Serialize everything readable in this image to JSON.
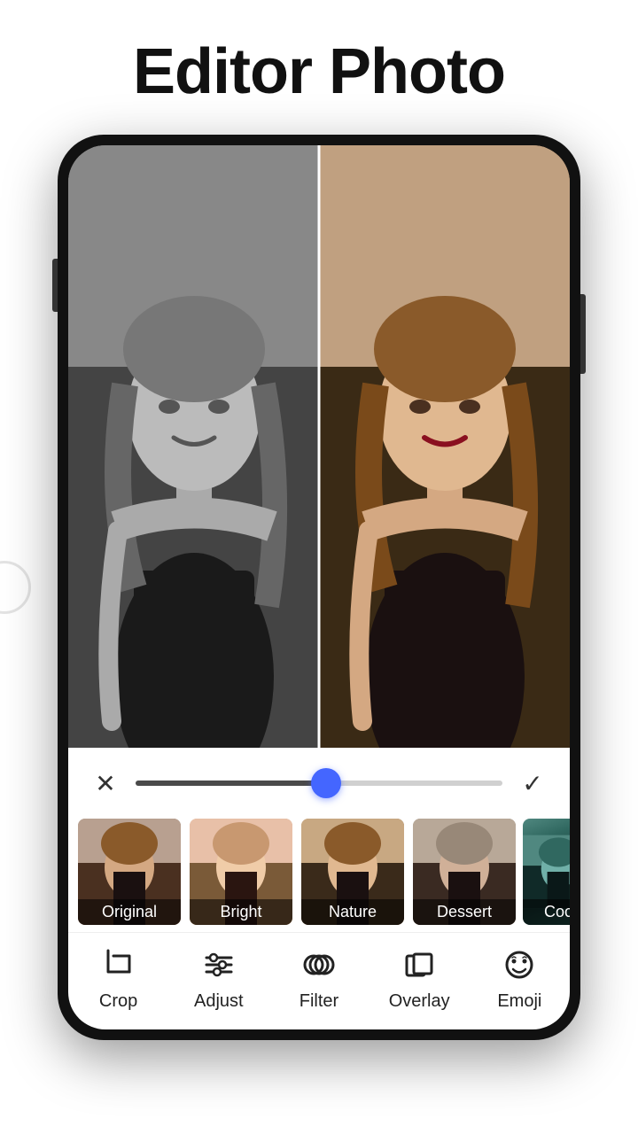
{
  "header": {
    "title": "Editor Photo"
  },
  "phone": {
    "slider_value": 52
  },
  "filters": [
    {
      "id": "original",
      "label": "Original",
      "thumb_class": "thumb-original"
    },
    {
      "id": "bright",
      "label": "Bright",
      "thumb_class": "thumb-bright"
    },
    {
      "id": "nature",
      "label": "Nature",
      "thumb_class": "thumb-nature"
    },
    {
      "id": "dessert",
      "label": "Dessert",
      "thumb_class": "thumb-dessert"
    },
    {
      "id": "coc",
      "label": "Coc",
      "thumb_class": "thumb-coc"
    }
  ],
  "toolbar": {
    "items": [
      {
        "id": "crop",
        "label": "Crop"
      },
      {
        "id": "adjust",
        "label": "Adjust"
      },
      {
        "id": "filter",
        "label": "Filter"
      },
      {
        "id": "overlay",
        "label": "Overlay"
      },
      {
        "id": "emoji",
        "label": "Emoji"
      }
    ]
  },
  "buttons": {
    "close": "✕",
    "check": "✓"
  }
}
